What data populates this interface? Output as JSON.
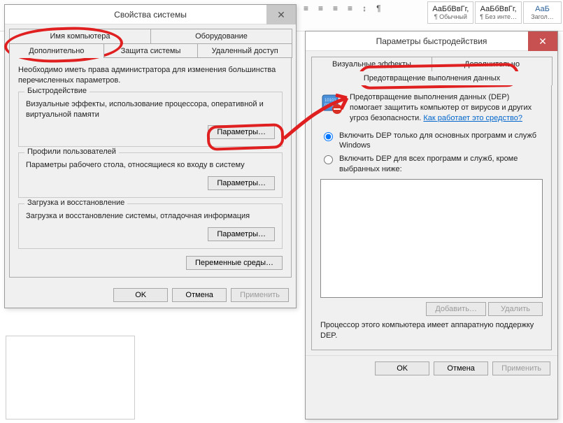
{
  "word_ribbon": {
    "style1": "АаБбВвГг,",
    "style2": "АаБбВвГг,",
    "style3": "АаБ",
    "name1": "¶ Обычный",
    "name2": "¶ Без инте…",
    "name3": "Загол…"
  },
  "sys": {
    "title": "Свойства системы",
    "tabs": {
      "t1": "Имя компьютера",
      "t2": "Оборудование",
      "t3": "Дополнительно",
      "t4": "Защита системы",
      "t5": "Удаленный доступ"
    },
    "intro": "Необходимо иметь права администратора для изменения большинства перечисленных параметров.",
    "g1": {
      "caption": "Быстродействие",
      "desc": "Визуальные эффекты, использование процессора, оперативной и виртуальной памяти",
      "btn": "Параметры…"
    },
    "g2": {
      "caption": "Профили пользователей",
      "desc": "Параметры рабочего стола, относящиеся ко входу в систему",
      "btn": "Параметры…"
    },
    "g3": {
      "caption": "Загрузка и восстановление",
      "desc": "Загрузка и восстановление системы, отладочная информация",
      "btn": "Параметры…"
    },
    "env_btn": "Переменные среды…",
    "ok": "OK",
    "cancel": "Отмена",
    "apply": "Применить"
  },
  "perf": {
    "title": "Параметры быстродействия",
    "tabs": {
      "t1": "Визуальные эффекты",
      "t2": "Дополнительно",
      "t3": "Предотвращение выполнения данных"
    },
    "dep_desc": "Предотвращение выполнения данных (DEP) помогает защитить компьютер от вирусов и других угроз безопасности. ",
    "dep_link": "Как работает это средство?",
    "radio1": "Включить DEP только для основных программ и служб Windows",
    "radio2": "Включить DEP для всех программ и служб, кроме выбранных ниже:",
    "add": "Добавить…",
    "del": "Удалить",
    "note": "Процессор этого компьютера имеет аппаратную поддержку DEP.",
    "ok": "OK",
    "cancel": "Отмена",
    "apply": "Применить"
  }
}
